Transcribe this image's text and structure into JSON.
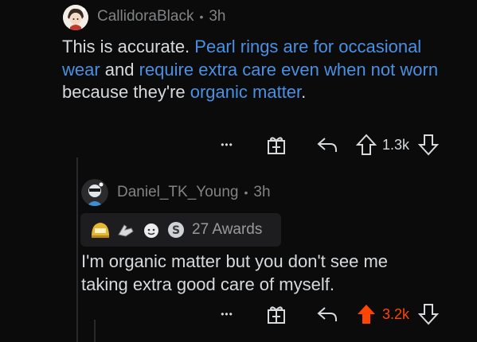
{
  "comments": [
    {
      "username": "CallidoraBlack",
      "time": "3h",
      "text": [
        {
          "t": "This is accurate. ",
          "link": false
        },
        {
          "t": "Pearl rings are for occasional wear",
          "link": true
        },
        {
          "t": " and ",
          "link": false
        },
        {
          "t": "require extra care even when not worn",
          "link": true
        },
        {
          "t": " because they're ",
          "link": false
        },
        {
          "t": "organic matter",
          "link": true
        },
        {
          "t": ".",
          "link": false
        }
      ],
      "more_label": "•••",
      "score": "1.3k",
      "upvoted": false
    },
    {
      "username": "Daniel_TK_Young",
      "time": "3h",
      "awards_label": "27 Awards",
      "award_icons": [
        "gold-helmet-award-icon",
        "hand-award-icon",
        "face-award-icon",
        "silver-s-award-icon"
      ],
      "text_line1": "I'm organic matter but you don't see me",
      "text_line2": "taking extra good care of myself.",
      "more_label": "•••",
      "score": "3.2k",
      "upvoted": true
    }
  ],
  "separator": "•",
  "colors": {
    "link": "#4a90e2",
    "upvote": "#ff4500",
    "background": "#0b0b0c"
  }
}
